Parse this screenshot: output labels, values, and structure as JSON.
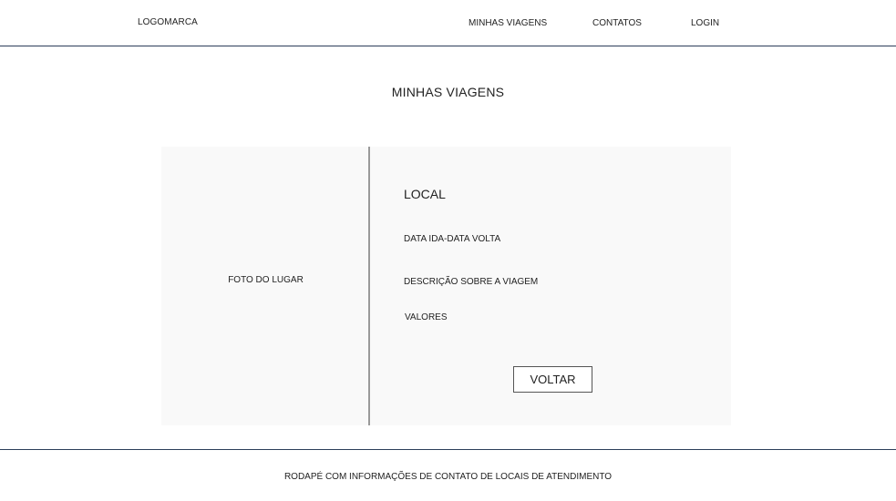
{
  "header": {
    "logo": "LOGOMARCA",
    "nav": {
      "trips": "MINHAS VIAGENS",
      "contacts": "CONTATOS",
      "login": "LOGIN"
    }
  },
  "main": {
    "title": "MINHAS VIAGENS",
    "card": {
      "photo_label": "FOTO DO LUGAR",
      "local": "LOCAL",
      "dates": "DATA IDA-DATA VOLTA",
      "description": "DESCRIÇÃO SOBRE A VIAGEM",
      "values": "VALORES",
      "back_button": "VOLTAR"
    }
  },
  "footer": {
    "text": "RODAPÉ COM INFORMAÇÕES DE CONTATO DE LOCAIS DE ATENDIMENTO"
  },
  "colors": {
    "divider": "#2c3e5a",
    "card_background": "#f9f9f9",
    "photo_divider": "#9a9a9a"
  }
}
